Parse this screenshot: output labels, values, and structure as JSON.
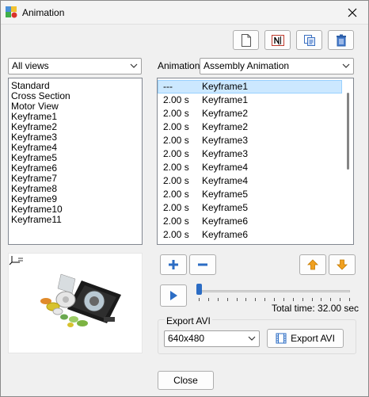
{
  "window": {
    "title": "Animation"
  },
  "toolbar": {
    "icons": [
      "new-document-icon",
      "rename-icon",
      "copy-icon",
      "delete-icon"
    ]
  },
  "views": {
    "selected": "All views",
    "items": [
      "Standard",
      "Cross Section",
      "Motor View",
      "Keyframe1",
      "Keyframe2",
      "Keyframe3",
      "Keyframe4",
      "Keyframe5",
      "Keyframe6",
      "Keyframe7",
      "Keyframe8",
      "Keyframe9",
      "Keyframe10",
      "Keyframe11"
    ]
  },
  "animation": {
    "label": "Animation",
    "selected": "Assembly Animation"
  },
  "keyframes": [
    {
      "time": "---",
      "name": "Keyframe1",
      "selected": true
    },
    {
      "time": "2.00 s",
      "name": "Keyframe1"
    },
    {
      "time": "2.00 s",
      "name": "Keyframe2"
    },
    {
      "time": "2.00 s",
      "name": "Keyframe2"
    },
    {
      "time": "2.00 s",
      "name": "Keyframe3"
    },
    {
      "time": "2.00 s",
      "name": "Keyframe3"
    },
    {
      "time": "2.00 s",
      "name": "Keyframe4"
    },
    {
      "time": "2.00 s",
      "name": "Keyframe4"
    },
    {
      "time": "2.00 s",
      "name": "Keyframe5"
    },
    {
      "time": "2.00 s",
      "name": "Keyframe5"
    },
    {
      "time": "2.00 s",
      "name": "Keyframe6"
    },
    {
      "time": "2.00 s",
      "name": "Keyframe6"
    }
  ],
  "playback": {
    "total_time": "Total time: 32.00 sec",
    "position": 0
  },
  "export": {
    "group_label": "Export AVI",
    "resolution": "640x480",
    "button_label": "Export AVI"
  },
  "footer": {
    "close_label": "Close"
  },
  "colors": {
    "accent_blue": "#2b6cc4",
    "accent_orange": "#f0a020",
    "selection": "#cce8ff"
  }
}
